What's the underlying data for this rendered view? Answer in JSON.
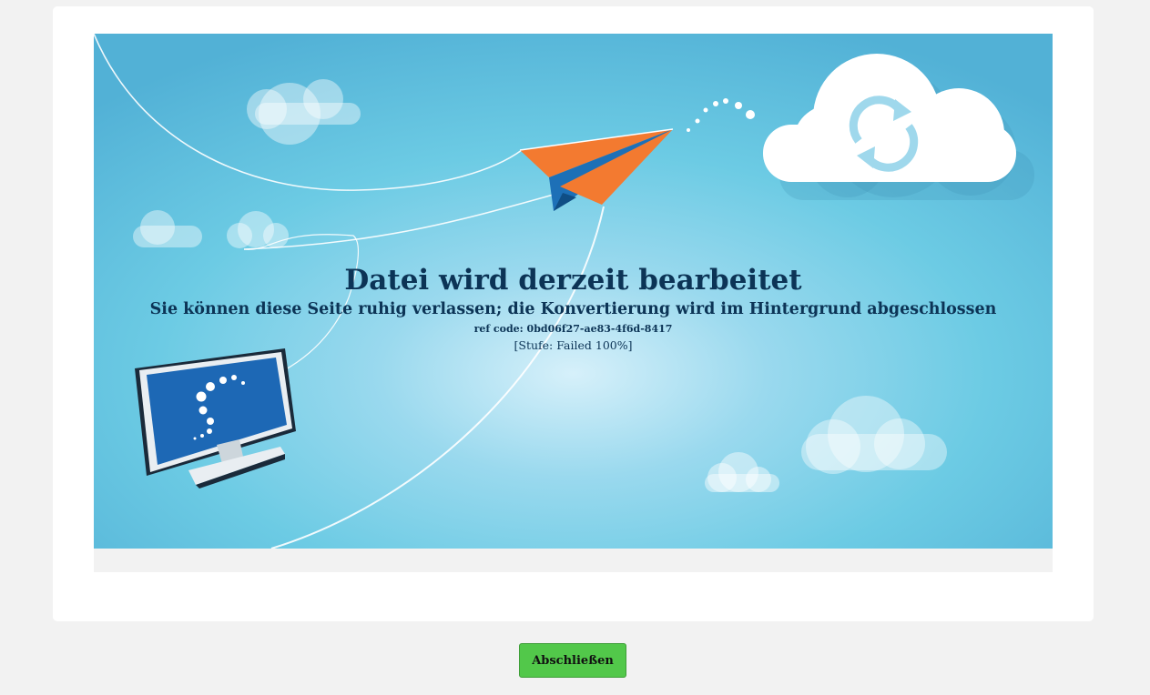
{
  "conversion": {
    "title": "Datei wird derzeit bearbeitet",
    "subtitle": "Sie können diese Seite ruhig verlassen; die Konvertierung wird im Hintergrund abgeschlossen",
    "ref_code": "ref code: 0bd06f27-ae83-4f6d-8417",
    "stage": "[Stufe: Failed 100%]"
  },
  "illustration": {
    "icons": [
      "paper-plane-icon",
      "cloud-sync-icon",
      "monitor-icon",
      "cloud-icon"
    ]
  },
  "actions": {
    "close_label": "Abschließen"
  },
  "colors": {
    "sky": "#6ccbe4",
    "sky_edge": "#52b1d6",
    "plane_orange": "#f37a30",
    "plane_blue": "#1d70b7",
    "text_dark": "#0c3456",
    "button_green": "#52c84a"
  }
}
